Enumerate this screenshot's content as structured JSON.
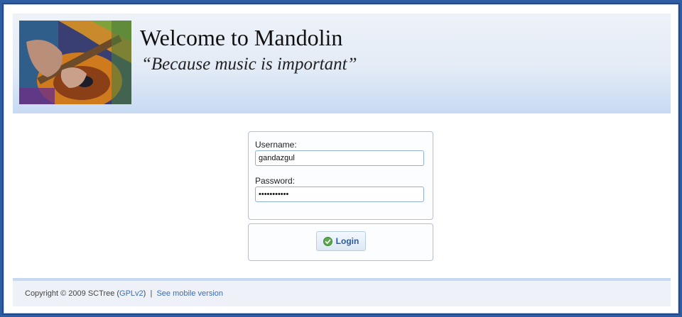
{
  "header": {
    "title": "Welcome to Mandolin",
    "tagline": "“Because music is important”"
  },
  "login": {
    "username_label": "Username:",
    "username_value": "gandazgul",
    "password_label": "Password:",
    "password_value": "gandazgulpw",
    "login_label": "Login"
  },
  "footer": {
    "copyright": "Copyright © 2009 SCTree (",
    "license_link": "GPLv2",
    "license_close": ")",
    "separator": "|",
    "mobile_link": "See mobile version"
  },
  "colors": {
    "accent": "#2a5aa0",
    "page_background": "#2f5da3",
    "header_gradient_end": "#c7daf3"
  }
}
